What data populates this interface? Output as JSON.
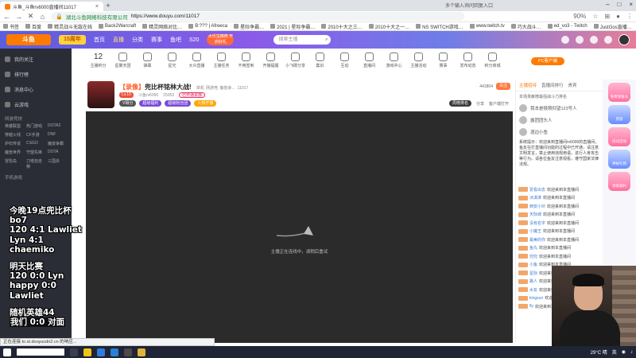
{
  "browser": {
    "tab_title": "斗鱼_斗鱼rv6000直播间11017",
    "tab_search_hint": "多个输入询问回复入口",
    "url_site_label": "湖北斗鱼网络科技有限公司",
    "url": "https://www.douyu.com/11017",
    "zoom": "90%",
    "bookmarks": [
      "书签",
      "百度",
      "精灵战斗无敌在线",
      "Back2Warcraft",
      "精灵网络对比…",
      "B:??? | Afreeca",
      "星际争霸…",
      "2021 | 星际争霸…",
      "2010十大之三…",
      "2010十大之一…",
      "NS SWITCH游戏…",
      "www.twitch.tv",
      "巧大战斗…",
      "ed_vo3 - Twitch",
      "JustGos直播…"
    ]
  },
  "site_header": {
    "logo": "斗鱼",
    "logo_badge": "15周年",
    "nav": [
      "首页",
      "直播",
      "分类",
      "赛事",
      "鱼吧",
      "S20"
    ],
    "promo": "大乐宝推荐 开启好礼",
    "search_placeholder": "搜索主播"
  },
  "sidebar": {
    "items": [
      "我的关注",
      "排行榜",
      "消息中心",
      "云游戏",
      "网游竞技"
    ],
    "section_title": "网游竞技",
    "grid": [
      "英雄联盟",
      "热门游戏",
      "DOTA2",
      "穿越火线",
      "CF手游",
      "DNF",
      "炉石传说",
      "CSGO",
      "魔兽争霸",
      "魔兽世界",
      "守望先锋",
      "DOTA",
      "冒险岛",
      "刀塔自走棋",
      "三国杀"
    ],
    "section2": "手机游戏"
  },
  "overlay_text": {
    "line1": "今晚19点兜比杯",
    "line2": "bo7",
    "line3": "120 4:1 Lawliet",
    "line4": "Lyn 4:1 chaemiko",
    "line5": "明天比赛",
    "line6": "120 0:0 Lyn",
    "line7": "happy 0:0 Lawliet",
    "line8": "随机英雄44",
    "line9": "我们 0:0 对面"
  },
  "catbar": {
    "count": "12",
    "items": [
      "主播积分",
      "星聚天团",
      "弹幕",
      "星光",
      "大众直播",
      "主播任务",
      "不用签到",
      "开播提醒",
      "小飞碟分享",
      "集训",
      "互动",
      "直播间",
      "游戏中心",
      "主播活动",
      "赛事",
      "发布动态",
      "积分商城",
      "主播门票",
      "锦囊",
      "红包",
      "更多"
    ],
    "promo": "PC客户端"
  },
  "room": {
    "title_prefix": "【录像】",
    "title": "兜比杯铭林大战!",
    "category": "单机",
    "category2": "网游竞",
    "category3": "魔兽争…",
    "room_id": "11017",
    "streamer": "斗鱼rv6000",
    "level_badge": "Lv.16",
    "fans": "25053",
    "fan_badge": "已开通贵族",
    "tag1": "V得分",
    "tag2": "超级福利",
    "tag3": "超级粉丝团",
    "tag4": "火热开播",
    "viewer_count": "441804",
    "follow_label": "关注",
    "rank_label": "周榜排名",
    "client_label": "客户端打开",
    "share_label": "分享"
  },
  "player": {
    "message": "主播正在连线中，请稍后重试"
  },
  "chat": {
    "tabs": [
      "主播招待",
      "直播间排行",
      "贵宾"
    ],
    "rank_hint": "本场贡献榜最强战斗力排名",
    "ranks": [
      {
        "name": "我本是极限仰望123号人"
      },
      {
        "name": "露团团头人"
      },
      {
        "name": "渡边小鱼"
      }
    ],
    "notice": "系统提示：欢迎来到直播间rv6000的直播间，鱼友在打直播间功能的过程中已开通，请注意文明发言，禁止使用违规用语，进行人身攻击等行为。请各位鱼友注意观看，遵守国家法律法规。",
    "danmu": [
      {
        "name": "爱看出去",
        "text": "欢迎来到本直播间"
      },
      {
        "name": "冰淇淋",
        "text": "欢迎来到本直播间"
      },
      {
        "name": "西安小伙",
        "text": "欢迎来到本直播间"
      },
      {
        "name": "天际城",
        "text": "欢迎来到本直播间"
      },
      {
        "name": "没有名字",
        "text": "欢迎来到本直播间"
      },
      {
        "name": "小魔王",
        "text": "欢迎来到本直播间"
      },
      {
        "name": "最美的你",
        "text": "欢迎来到本直播间"
      },
      {
        "name": "鱼丸",
        "text": "欢迎来到本直播间"
      },
      {
        "name": "兜兜",
        "text": "欢迎来到本直播间"
      },
      {
        "name": "小鱼",
        "text": "欢迎来到本直播间"
      },
      {
        "name": "星际",
        "text": "欢迎来到本直播间"
      },
      {
        "name": "路人",
        "text": "欢迎来到本直播间"
      },
      {
        "name": "水友",
        "text": "欢迎来到本直播间"
      },
      {
        "name": "kingsun",
        "text": "欢迎来到本直播间"
      },
      {
        "name": "fly",
        "text": "欢迎来到本直播间"
      }
    ]
  },
  "right_side": {
    "items": [
      "免费领鱼丸",
      "贵族",
      "房间活动",
      "神秘礼物",
      "领取福利"
    ]
  },
  "status_url": "正在连接 to.st.douyucdn2.cn 的响应...",
  "taskbar": {
    "weather": "29°C 晴",
    "ime": "英",
    "time": "",
    "colors": {
      "bg": "#1f2535"
    }
  }
}
